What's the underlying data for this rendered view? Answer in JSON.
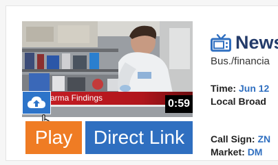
{
  "video": {
    "caption": "arma Findings",
    "duration": "0:59"
  },
  "buttons": {
    "play": "Play",
    "direct_link": "Direct Link"
  },
  "info": {
    "title": "News",
    "category": "Bus./financia",
    "time_label": "Time:",
    "time_value": "Jun 12",
    "broadcast": "Local Broad",
    "call_sign_label": "Call Sign:",
    "call_sign_value": "ZN",
    "market_label": "Market:",
    "market_value": "DM"
  },
  "icons": {
    "upload": "cloud-upload-icon",
    "cursor": "hand-pointer-icon",
    "tv": "tv-icon"
  },
  "colors": {
    "play_button": "#ef7c24",
    "link_button": "#2f6fc0",
    "caption_bar": "#c81e25",
    "title": "#233b6a",
    "value_text": "#2f6fc0"
  }
}
